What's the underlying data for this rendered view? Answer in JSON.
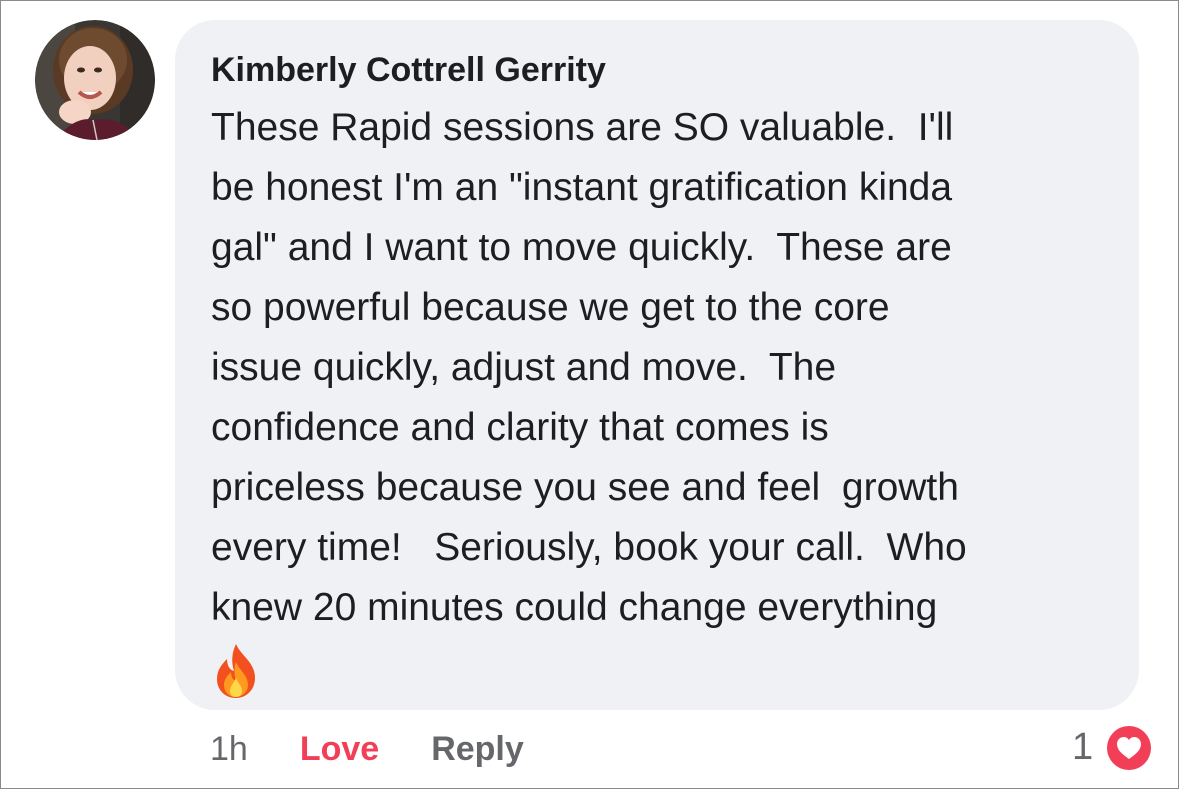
{
  "comment": {
    "author": "Kimberly Cottrell Gerrity",
    "text_lines": [
      "These Rapid sessions are SO valuable.  I'll",
      "be honest I'm an \"instant gratification kinda",
      "gal\" and I want to move quickly.  These are",
      "so powerful because we get to the core",
      "issue quickly, adjust and move.  The",
      "confidence and clarity that comes is",
      "priceless because you see and feel  growth",
      "every time!   Seriously, book your call.  Who",
      "knew 20 minutes could change everything"
    ],
    "emoji": "fire-emoji",
    "avatar": "profile-photo"
  },
  "actions": {
    "time": "1h",
    "love_label": "Love",
    "reply_label": "Reply"
  },
  "reactions": {
    "count": "1",
    "icon": "heart-icon"
  },
  "colors": {
    "bubble_bg": "#f0f1f5",
    "love": "#f33e58",
    "secondary_text": "#65676b",
    "primary_text": "#1c1e21",
    "heart_badge": "#f33e58"
  }
}
